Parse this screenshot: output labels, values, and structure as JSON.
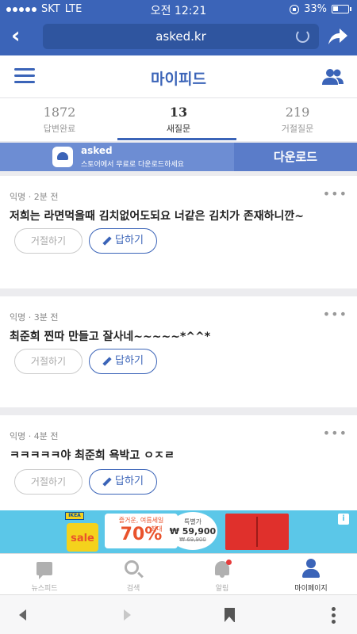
{
  "status_bar": {
    "carrier": "SKT",
    "network": "LTE",
    "time": "오전 12:21",
    "battery": "33%"
  },
  "browser": {
    "url": "asked.kr"
  },
  "header": {
    "title": "마이피드"
  },
  "stats": [
    {
      "count": "1872",
      "label": "답변완료"
    },
    {
      "count": "13",
      "label": "새질문"
    },
    {
      "count": "219",
      "label": "거절질문"
    }
  ],
  "banner": {
    "app_name": "asked",
    "subtitle": "스토어에서 무료로 다운로드하세요",
    "download_label": "다운로드"
  },
  "questions": [
    {
      "meta": "익명 · 2분 전",
      "text": "저희는 라면먹을때 김치없어도되요 너같은 김치가 존재하니깐~",
      "reject_label": "거절하기",
      "answer_label": "답하기"
    },
    {
      "meta": "익명 · 3분 전",
      "text": "최준희 찐따 만들고 잘사네~~~~~*^^*",
      "reject_label": "거절하기",
      "answer_label": "답하기"
    },
    {
      "meta": "익명 · 4분 전",
      "text": "ㅋㅋㅋㅋㅋ야 최준희 욕박고 ㅇㅈㄹ",
      "reject_label": "거절하기",
      "answer_label": "답하기"
    }
  ],
  "ad": {
    "brand": "IKEA",
    "headline": "즐거운, 여름세일",
    "sale_word": "sale",
    "max_label": "최대",
    "discount": "70%",
    "price_label": "특별가",
    "price": "₩ 59,900",
    "original_price": "₩ 69,900"
  },
  "tabbar": [
    {
      "label": "뉴스피드"
    },
    {
      "label": "검색"
    },
    {
      "label": "알림"
    },
    {
      "label": "마이페이지"
    }
  ],
  "colors": {
    "brand_blue": "#3b64b8",
    "ad_background": "#5bc7e8",
    "notification_dot": "#e63b3b"
  }
}
